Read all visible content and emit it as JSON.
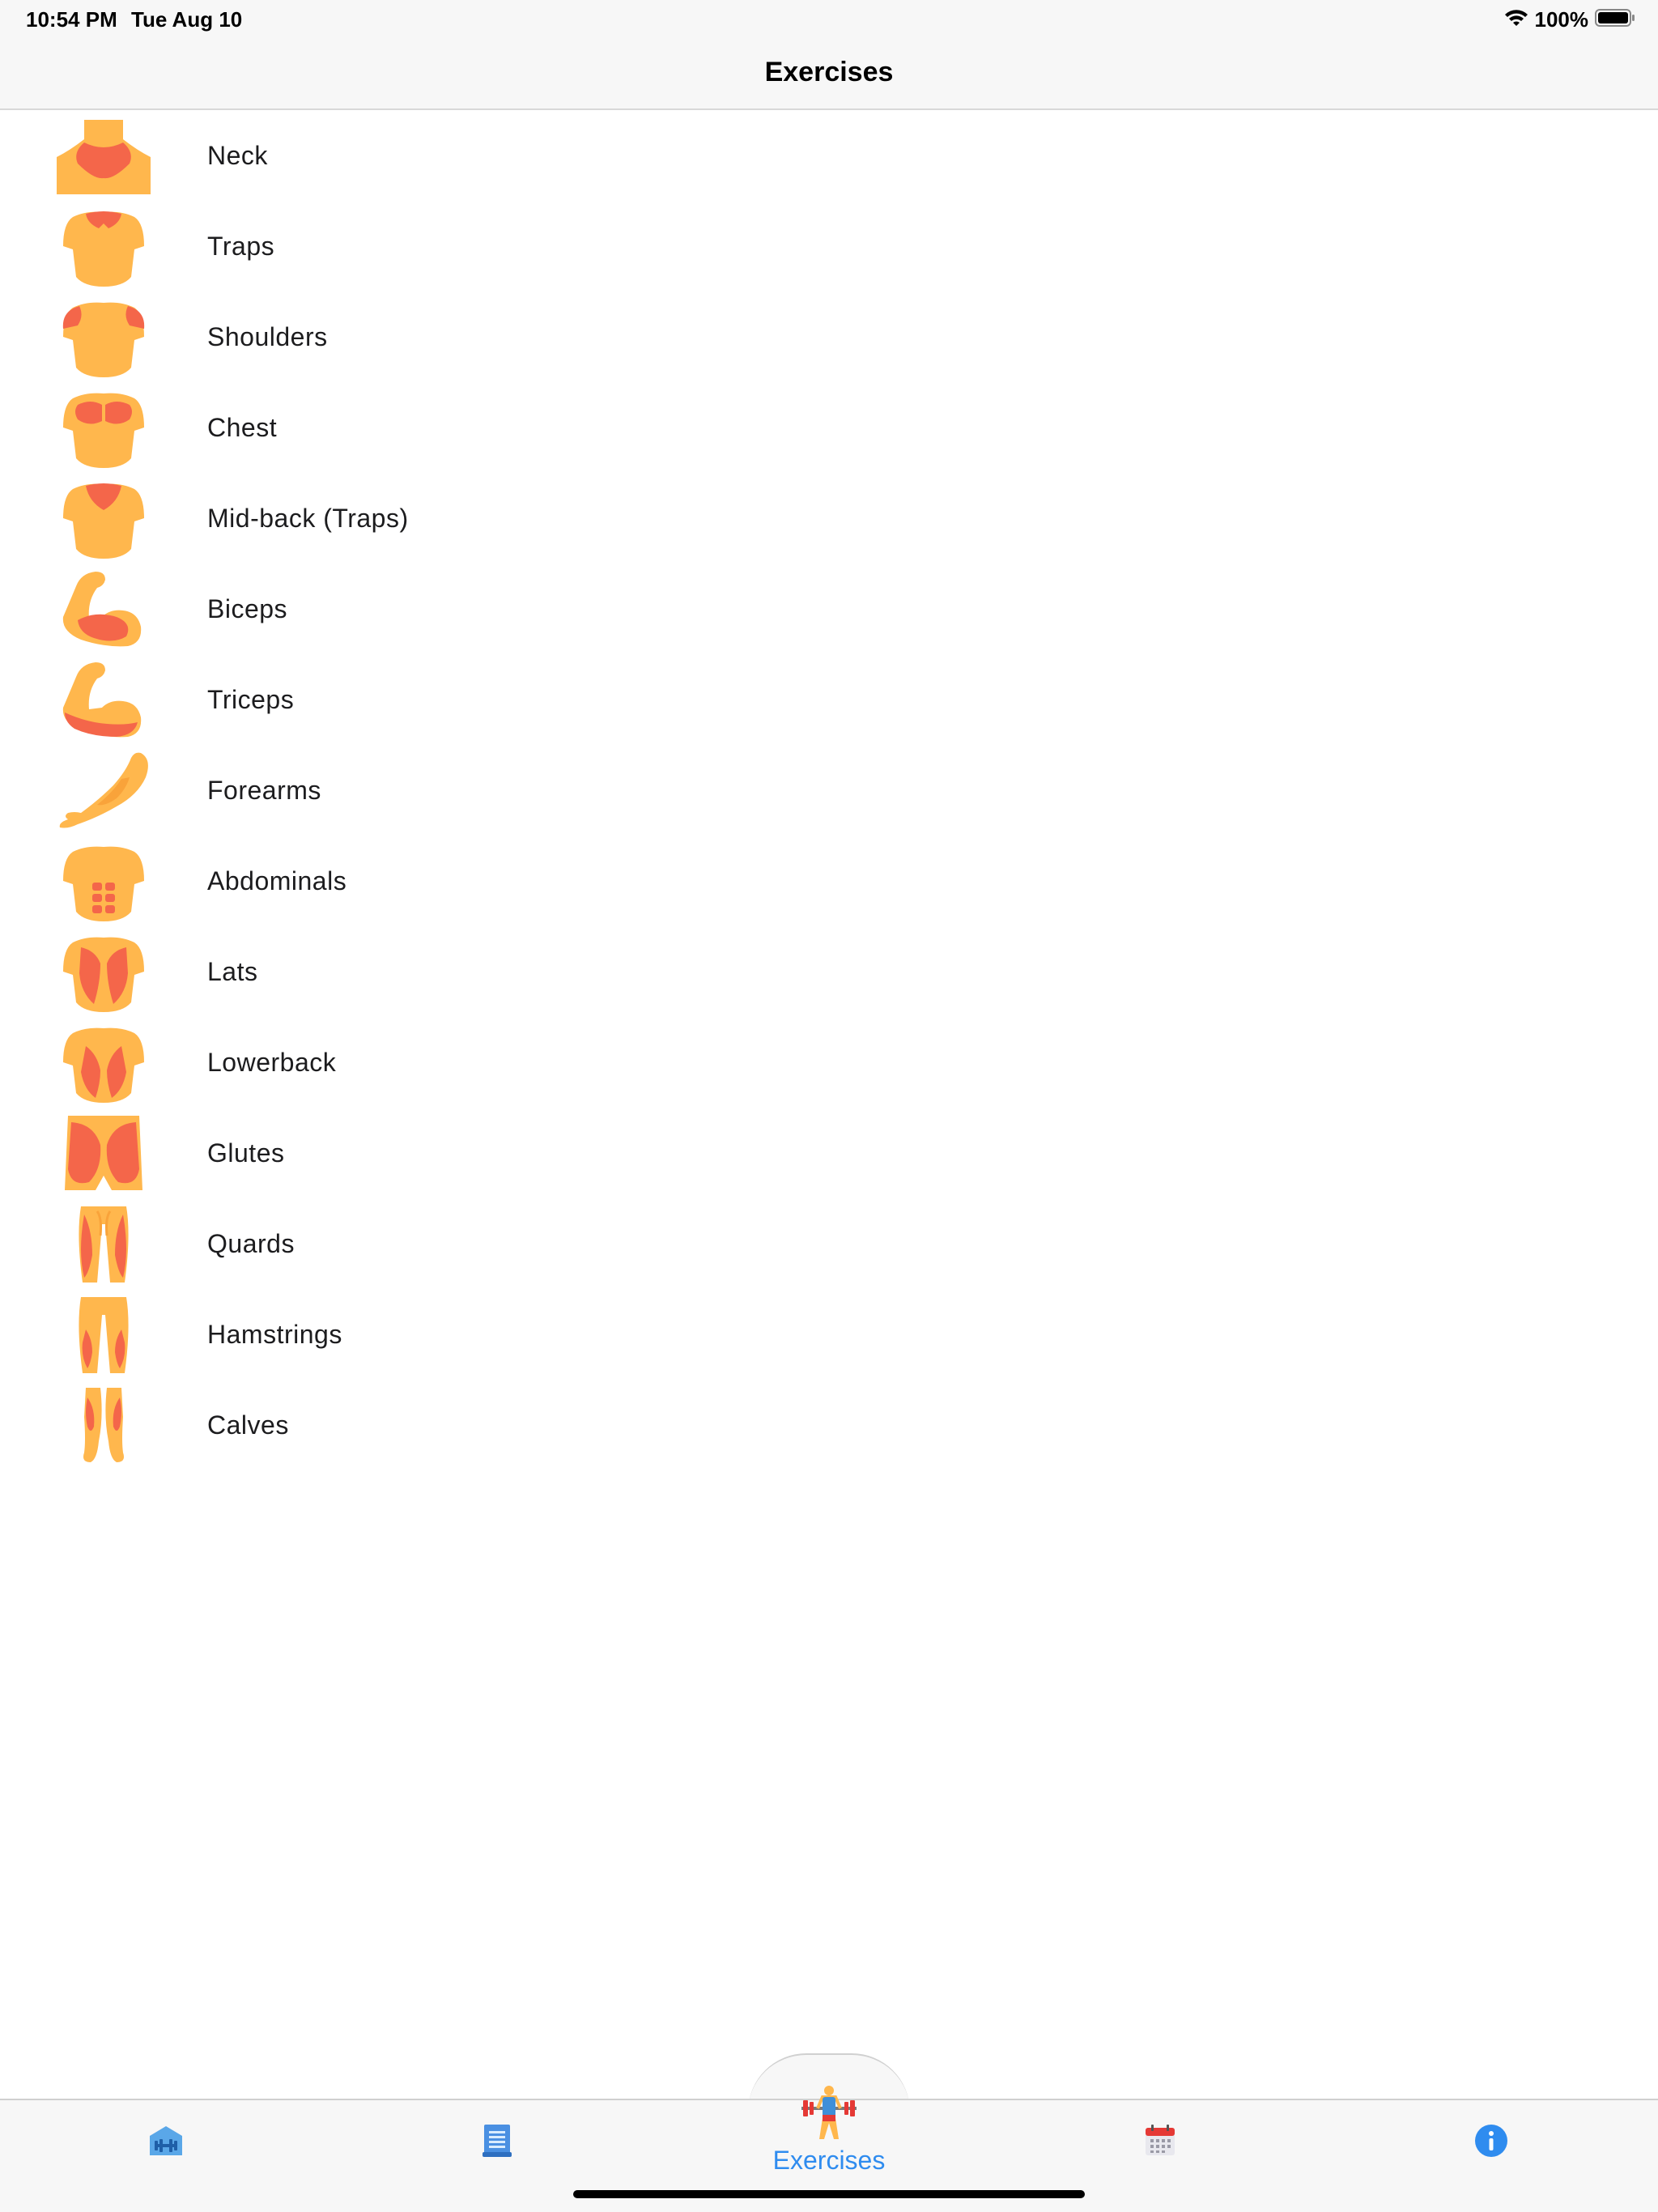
{
  "status_bar": {
    "time": "10:54 PM",
    "date": "Tue Aug 10",
    "battery_percent": "100%",
    "wifi_icon": "wifi-icon",
    "battery_icon": "battery-icon"
  },
  "nav": {
    "title": "Exercises"
  },
  "muscles": [
    {
      "label": "Neck",
      "icon": "neck-icon"
    },
    {
      "label": "Traps",
      "icon": "traps-icon"
    },
    {
      "label": "Shoulders",
      "icon": "shoulders-icon"
    },
    {
      "label": "Chest",
      "icon": "chest-icon"
    },
    {
      "label": "Mid-back (Traps)",
      "icon": "mid-back-icon"
    },
    {
      "label": "Biceps",
      "icon": "biceps-icon"
    },
    {
      "label": "Triceps",
      "icon": "triceps-icon"
    },
    {
      "label": "Forearms",
      "icon": "forearms-icon"
    },
    {
      "label": "Abdominals",
      "icon": "abdominals-icon"
    },
    {
      "label": "Lats",
      "icon": "lats-icon"
    },
    {
      "label": "Lowerback",
      "icon": "lowerback-icon"
    },
    {
      "label": "Glutes",
      "icon": "glutes-icon"
    },
    {
      "label": "Quards",
      "icon": "quads-icon"
    },
    {
      "label": "Hamstrings",
      "icon": "hamstrings-icon"
    },
    {
      "label": "Calves",
      "icon": "calves-icon"
    }
  ],
  "tab_bar": {
    "items": [
      {
        "icon": "gym-home-icon",
        "label": ""
      },
      {
        "icon": "workout-log-icon",
        "label": ""
      },
      {
        "icon": "weightlifter-icon",
        "label": "Exercises",
        "active": true
      },
      {
        "icon": "calendar-icon",
        "label": ""
      },
      {
        "icon": "info-icon",
        "label": ""
      }
    ]
  },
  "colors": {
    "skin": "#ffb74d",
    "muscle": "#f4664a",
    "accent": "#2f8cef",
    "bar_background": "#f7f7f7"
  }
}
